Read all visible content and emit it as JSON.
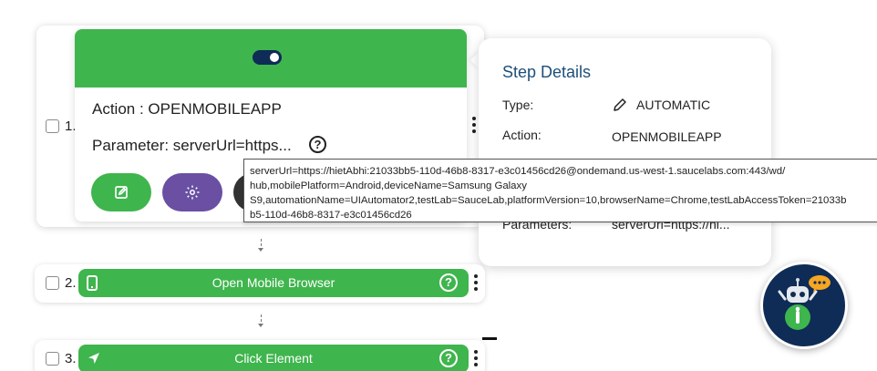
{
  "steps": [
    {
      "number": "1.",
      "action": "Action : OPENMOBILEAPP",
      "parameter": "Parameter: serverUrl=https...",
      "enabled": true
    },
    {
      "number": "2.",
      "title": "Open Mobile Browser",
      "icon": "mobile-phone-icon"
    },
    {
      "number": "3.",
      "title": "Click Element",
      "icon": "cursor-arrow-icon"
    }
  ],
  "tooltip": {
    "text": "serverUrl=https://hietAbhi:21033bb5-110d-46b8-8317-e3c01456cd26@ondemand.us-west-1.saucelabs.com:443/wd/\nhub,mobilePlatform=Android,deviceName=Samsung Galaxy\nS9,automationName=UIAutomator2,testLab=SauceLab,platformVersion=10,browserName=Chrome,testLabAccessToken=21033b\nb5-110d-46b8-8317-e3c01456cd26"
  },
  "details": {
    "title": "Step Details",
    "type_label": "Type:",
    "type_value": "AUTOMATIC",
    "action_label": "Action:",
    "action_value": "OPENMOBILEAPP",
    "parameters_label": "Parameters:",
    "parameters_value": "serverUrl=https://hi..."
  },
  "colors": {
    "green": "#3fb54d",
    "navy": "#0e2c56",
    "purple": "#6a4fa3",
    "dark": "#333333"
  }
}
